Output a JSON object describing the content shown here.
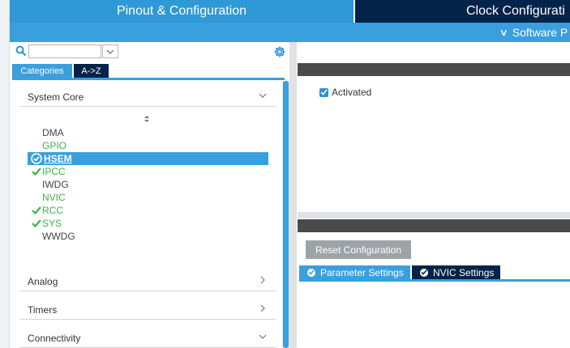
{
  "top_tabs": {
    "pinout": "Pinout & Configuration",
    "clock": "Clock Configurati"
  },
  "sub_bar": {
    "software_packs": "Software P"
  },
  "left": {
    "tabs": {
      "categories": "Categories",
      "az": "A->Z"
    },
    "search": {
      "value": "",
      "placeholder": ""
    },
    "categories": [
      {
        "label": "System Core",
        "state": "expanded"
      },
      {
        "label": "Analog",
        "state": "collapsed"
      },
      {
        "label": "Timers",
        "state": "collapsed"
      },
      {
        "label": "Connectivity",
        "state": "expanded"
      }
    ],
    "peripherals": [
      {
        "label": "DMA",
        "status": "none",
        "color": "grey"
      },
      {
        "label": "GPIO",
        "status": "none",
        "color": "green"
      },
      {
        "label": "HSEM",
        "status": "selected-ok",
        "color": "white"
      },
      {
        "label": "IPCC",
        "status": "ok",
        "color": "green"
      },
      {
        "label": "IWDG",
        "status": "none",
        "color": "grey"
      },
      {
        "label": "NVIC",
        "status": "none",
        "color": "green"
      },
      {
        "label": "RCC",
        "status": "ok",
        "color": "green"
      },
      {
        "label": "SYS",
        "status": "ok",
        "color": "green"
      },
      {
        "label": "WWDG",
        "status": "none",
        "color": "grey"
      }
    ]
  },
  "right": {
    "mode": {
      "activated_label": "Activated",
      "activated_checked": true
    },
    "reset_button": "Reset Configuration",
    "config_tabs": [
      {
        "label": "Parameter Settings",
        "active": true
      },
      {
        "label": "NVIC Settings",
        "active": false
      }
    ]
  },
  "colors": {
    "accent": "#3a9fdd",
    "dark_navy": "#03234b",
    "ok_green": "#3db14a"
  }
}
